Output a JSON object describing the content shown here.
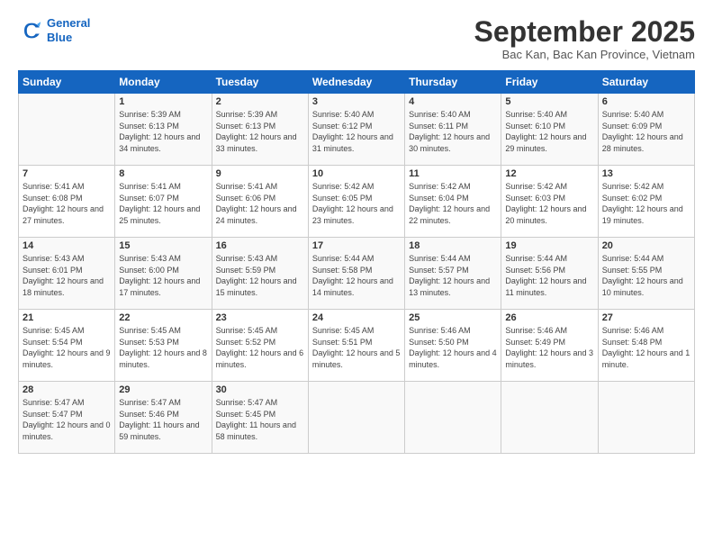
{
  "logo": {
    "line1": "General",
    "line2": "Blue"
  },
  "title": "September 2025",
  "location": "Bac Kan, Bac Kan Province, Vietnam",
  "header_days": [
    "Sunday",
    "Monday",
    "Tuesday",
    "Wednesday",
    "Thursday",
    "Friday",
    "Saturday"
  ],
  "weeks": [
    [
      {
        "day": "",
        "info": ""
      },
      {
        "day": "1",
        "info": "Sunrise: 5:39 AM\nSunset: 6:13 PM\nDaylight: 12 hours\nand 34 minutes."
      },
      {
        "day": "2",
        "info": "Sunrise: 5:39 AM\nSunset: 6:13 PM\nDaylight: 12 hours\nand 33 minutes."
      },
      {
        "day": "3",
        "info": "Sunrise: 5:40 AM\nSunset: 6:12 PM\nDaylight: 12 hours\nand 31 minutes."
      },
      {
        "day": "4",
        "info": "Sunrise: 5:40 AM\nSunset: 6:11 PM\nDaylight: 12 hours\nand 30 minutes."
      },
      {
        "day": "5",
        "info": "Sunrise: 5:40 AM\nSunset: 6:10 PM\nDaylight: 12 hours\nand 29 minutes."
      },
      {
        "day": "6",
        "info": "Sunrise: 5:40 AM\nSunset: 6:09 PM\nDaylight: 12 hours\nand 28 minutes."
      }
    ],
    [
      {
        "day": "7",
        "info": "Sunrise: 5:41 AM\nSunset: 6:08 PM\nDaylight: 12 hours\nand 27 minutes."
      },
      {
        "day": "8",
        "info": "Sunrise: 5:41 AM\nSunset: 6:07 PM\nDaylight: 12 hours\nand 25 minutes."
      },
      {
        "day": "9",
        "info": "Sunrise: 5:41 AM\nSunset: 6:06 PM\nDaylight: 12 hours\nand 24 minutes."
      },
      {
        "day": "10",
        "info": "Sunrise: 5:42 AM\nSunset: 6:05 PM\nDaylight: 12 hours\nand 23 minutes."
      },
      {
        "day": "11",
        "info": "Sunrise: 5:42 AM\nSunset: 6:04 PM\nDaylight: 12 hours\nand 22 minutes."
      },
      {
        "day": "12",
        "info": "Sunrise: 5:42 AM\nSunset: 6:03 PM\nDaylight: 12 hours\nand 20 minutes."
      },
      {
        "day": "13",
        "info": "Sunrise: 5:42 AM\nSunset: 6:02 PM\nDaylight: 12 hours\nand 19 minutes."
      }
    ],
    [
      {
        "day": "14",
        "info": "Sunrise: 5:43 AM\nSunset: 6:01 PM\nDaylight: 12 hours\nand 18 minutes."
      },
      {
        "day": "15",
        "info": "Sunrise: 5:43 AM\nSunset: 6:00 PM\nDaylight: 12 hours\nand 17 minutes."
      },
      {
        "day": "16",
        "info": "Sunrise: 5:43 AM\nSunset: 5:59 PM\nDaylight: 12 hours\nand 15 minutes."
      },
      {
        "day": "17",
        "info": "Sunrise: 5:44 AM\nSunset: 5:58 PM\nDaylight: 12 hours\nand 14 minutes."
      },
      {
        "day": "18",
        "info": "Sunrise: 5:44 AM\nSunset: 5:57 PM\nDaylight: 12 hours\nand 13 minutes."
      },
      {
        "day": "19",
        "info": "Sunrise: 5:44 AM\nSunset: 5:56 PM\nDaylight: 12 hours\nand 11 minutes."
      },
      {
        "day": "20",
        "info": "Sunrise: 5:44 AM\nSunset: 5:55 PM\nDaylight: 12 hours\nand 10 minutes."
      }
    ],
    [
      {
        "day": "21",
        "info": "Sunrise: 5:45 AM\nSunset: 5:54 PM\nDaylight: 12 hours\nand 9 minutes."
      },
      {
        "day": "22",
        "info": "Sunrise: 5:45 AM\nSunset: 5:53 PM\nDaylight: 12 hours\nand 8 minutes."
      },
      {
        "day": "23",
        "info": "Sunrise: 5:45 AM\nSunset: 5:52 PM\nDaylight: 12 hours\nand 6 minutes."
      },
      {
        "day": "24",
        "info": "Sunrise: 5:45 AM\nSunset: 5:51 PM\nDaylight: 12 hours\nand 5 minutes."
      },
      {
        "day": "25",
        "info": "Sunrise: 5:46 AM\nSunset: 5:50 PM\nDaylight: 12 hours\nand 4 minutes."
      },
      {
        "day": "26",
        "info": "Sunrise: 5:46 AM\nSunset: 5:49 PM\nDaylight: 12 hours\nand 3 minutes."
      },
      {
        "day": "27",
        "info": "Sunrise: 5:46 AM\nSunset: 5:48 PM\nDaylight: 12 hours\nand 1 minute."
      }
    ],
    [
      {
        "day": "28",
        "info": "Sunrise: 5:47 AM\nSunset: 5:47 PM\nDaylight: 12 hours\nand 0 minutes."
      },
      {
        "day": "29",
        "info": "Sunrise: 5:47 AM\nSunset: 5:46 PM\nDaylight: 11 hours\nand 59 minutes."
      },
      {
        "day": "30",
        "info": "Sunrise: 5:47 AM\nSunset: 5:45 PM\nDaylight: 11 hours\nand 58 minutes."
      },
      {
        "day": "",
        "info": ""
      },
      {
        "day": "",
        "info": ""
      },
      {
        "day": "",
        "info": ""
      },
      {
        "day": "",
        "info": ""
      }
    ]
  ]
}
